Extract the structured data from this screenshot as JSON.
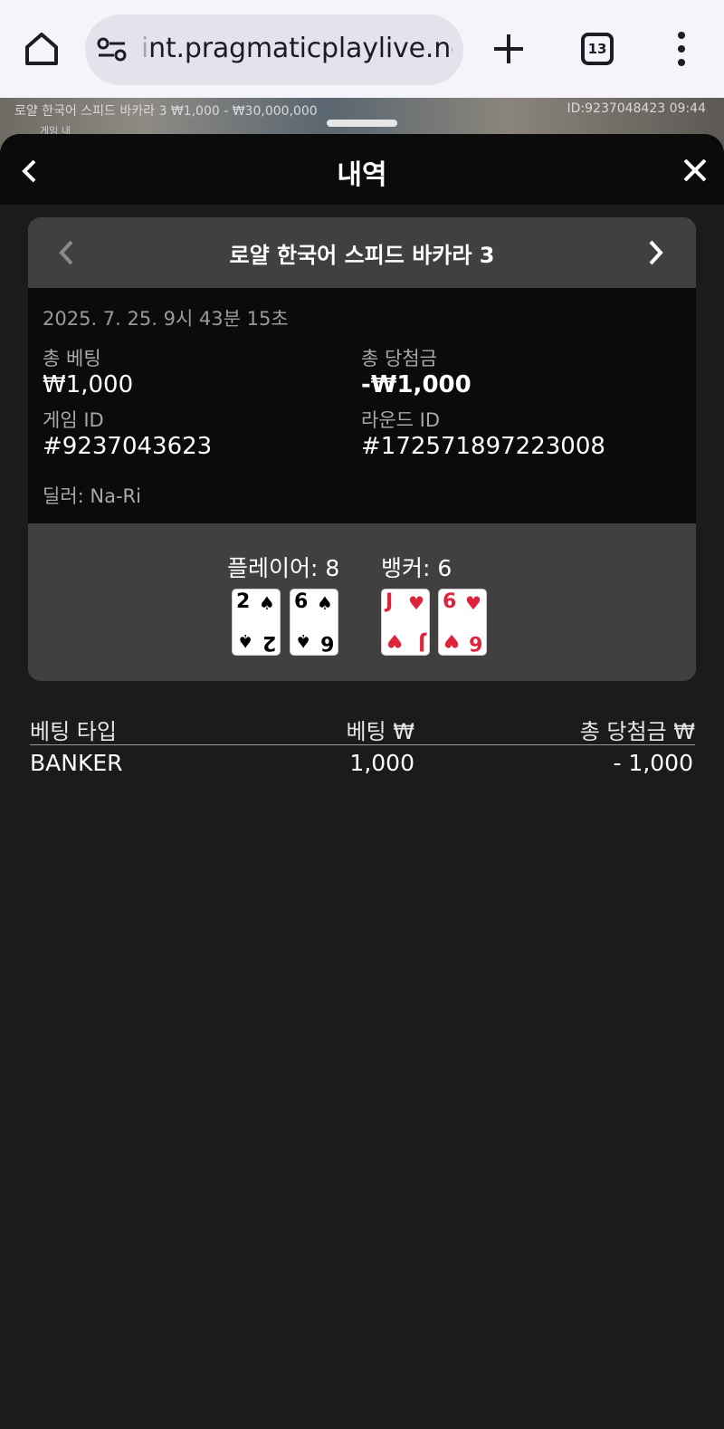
{
  "browser": {
    "url_faded": "i",
    "url": "nt.pragmaticplaylive.net",
    "tab_count": "13"
  },
  "game_strip": {
    "left_text": "로얄 한국어 스피드 바카라 3  ₩1,000 - ₩30,000,000",
    "right_text": "ID:9237048423  09:44",
    "sub_text": "게임 내"
  },
  "history": {
    "title": "내역",
    "game_name": "로얄 한국어 스피드 바카라 3",
    "datetime": "2025. 7. 25. 9시 43분 15초",
    "total_bet_label": "총 베팅",
    "total_bet_value": "₩1,000",
    "total_win_label": "총 당첨금",
    "total_win_value": "-₩1,000",
    "game_id_label": "게임 ID",
    "game_id_value": "#9237043623",
    "round_id_label": "라운드 ID",
    "round_id_value": "#172571897223008",
    "dealer": "딜러: Na-Ri",
    "player_label": "플레이어: 8",
    "banker_label": "뱅커: 6",
    "player_cards": [
      {
        "rank": "2",
        "suit": "♠",
        "color": "#000000"
      },
      {
        "rank": "6",
        "suit": "♠",
        "color": "#000000"
      }
    ],
    "banker_cards": [
      {
        "rank": "J",
        "suit": "♥",
        "color": "#e0233b"
      },
      {
        "rank": "6",
        "suit": "♥",
        "color": "#e0233b"
      }
    ]
  },
  "bets_table": {
    "headers": [
      "베팅 타입",
      "베팅 ₩",
      "총 당첨금 ₩"
    ],
    "rows": [
      [
        "BANKER",
        "1,000",
        "- 1,000"
      ]
    ]
  },
  "icons": [
    "home-icon",
    "site-settings-icon",
    "new-tab-icon",
    "tab-switcher-icon",
    "more-menu-icon",
    "back-icon",
    "close-icon",
    "chevron-left-icon",
    "chevron-right-icon"
  ]
}
